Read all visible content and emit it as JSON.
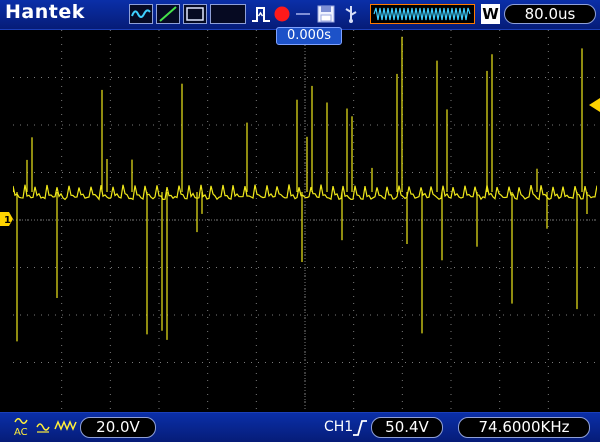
{
  "brand": "Hantek",
  "trigger_position": "0.000s",
  "timebase_mode": "W",
  "timebase": "80.0us",
  "channel": {
    "marker": "1",
    "coupling": "AC",
    "volts_per_div": "20.0V"
  },
  "trigger": {
    "source": "CH1",
    "level": "50.4V",
    "frequency": "74.6000KHz"
  },
  "colors": {
    "trace": "#f0e81a",
    "bar": "#0a2fa8",
    "grid": "#7a7a7a",
    "trigger_arrow": "#ffd400"
  }
}
